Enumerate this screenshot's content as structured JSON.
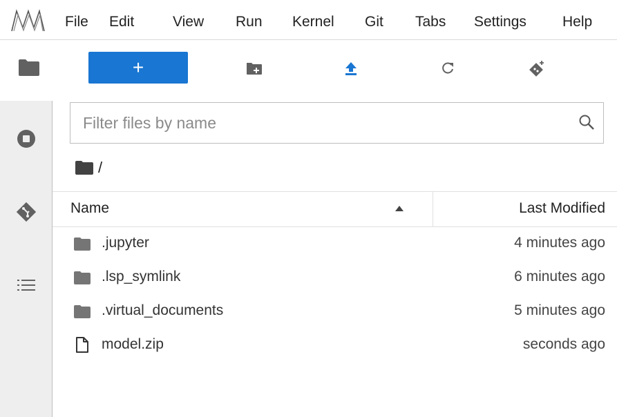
{
  "menubar": {
    "items": [
      "File",
      "Edit",
      "View",
      "Run",
      "Kernel",
      "Git",
      "Tabs",
      "Settings",
      "Help"
    ]
  },
  "toolbar": {
    "new_launcher_label": "+"
  },
  "filter": {
    "placeholder": "Filter files by name"
  },
  "breadcrumb": {
    "path": "/"
  },
  "listing": {
    "columns": {
      "name": "Name",
      "last_modified": "Last Modified"
    },
    "rows": [
      {
        "name": ".jupyter",
        "type": "folder",
        "modified": "4 minutes ago"
      },
      {
        "name": ".lsp_symlink",
        "type": "folder",
        "modified": "6 minutes ago"
      },
      {
        "name": ".virtual_documents",
        "type": "folder",
        "modified": "5 minutes ago"
      },
      {
        "name": "model.zip",
        "type": "file",
        "modified": "seconds ago"
      }
    ]
  },
  "colors": {
    "accent": "#1976d2",
    "activity_bar": "#eeeeee"
  },
  "icons": {
    "logo": "jupyter-logo-icon",
    "file_browser": "folder-icon",
    "new_folder": "new-folder-icon",
    "upload": "upload-icon",
    "refresh": "refresh-icon",
    "git_clone": "git-clone-icon",
    "running": "stop-circle-icon",
    "git": "git-icon",
    "toc": "list-icon",
    "search": "search-icon",
    "sort": "sort-ascending-icon"
  }
}
